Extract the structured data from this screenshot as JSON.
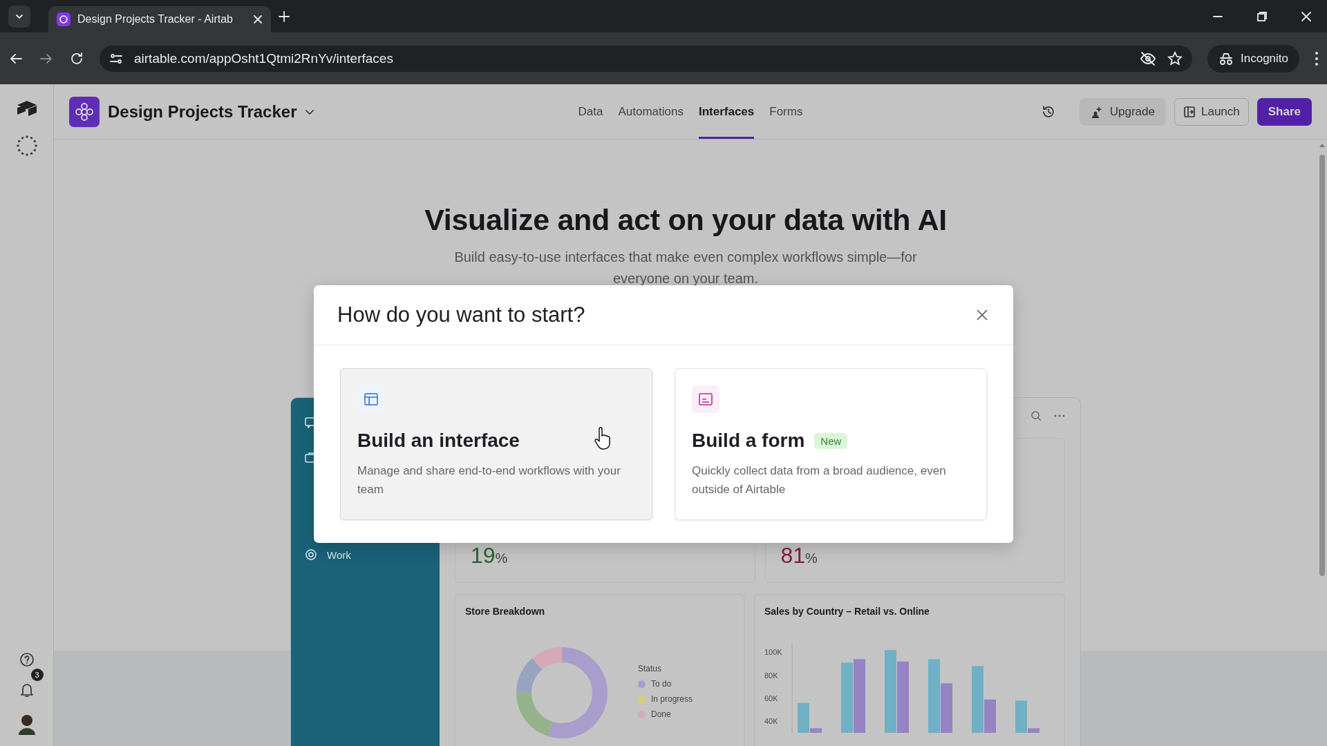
{
  "browser": {
    "tab_title": "Design Projects Tracker - Airtab",
    "url": "airtable.com/appOsht1Qtmi2RnYv/interfaces",
    "profile": "Incognito"
  },
  "rail": {
    "notification_count": "3"
  },
  "header": {
    "base_name": "Design Projects Tracker",
    "nav": [
      {
        "label": "Data",
        "selected": false
      },
      {
        "label": "Automations",
        "selected": false
      },
      {
        "label": "Interfaces",
        "selected": true
      },
      {
        "label": "Forms",
        "selected": false
      }
    ],
    "buttons": [
      {
        "label": "Upgrade",
        "kind": "upgrade"
      },
      {
        "label": "Launch",
        "kind": "launch"
      },
      {
        "label": "Share",
        "kind": "share"
      }
    ]
  },
  "hero": {
    "title": "Visualize and act on your data with AI",
    "subtitle": "Build easy-to-use interfaces that make even complex workflows simple—for everyone on your team."
  },
  "preview": {
    "sidebar_items": [
      {
        "label": "Work"
      }
    ],
    "metrics": [
      {
        "value": "19",
        "unit": "%",
        "color": "#2b6030"
      },
      {
        "value": "81",
        "unit": "%",
        "color": "#8a1a3e"
      }
    ],
    "store_breakdown": {
      "title": "Store Breakdown",
      "legend_title": "Status",
      "legend": [
        {
          "label": "To do",
          "color": "#a99dcc"
        },
        {
          "label": "In progress",
          "color": "#d2cf7a"
        },
        {
          "label": "Done",
          "color": "#d6a9b6"
        }
      ]
    },
    "sales_chart": {
      "chart_data": {
        "type": "bar",
        "title": "Sales by Country – Retail vs. Online",
        "categories": [
          null,
          null,
          null,
          null,
          null,
          null
        ],
        "ylim": [
          30000,
          108000
        ],
        "yticks": [
          {
            "value": 40000,
            "label": "40K"
          },
          {
            "value": 60000,
            "label": "60K"
          },
          {
            "value": 80000,
            "label": "80K"
          },
          {
            "value": 100000,
            "label": "100K"
          }
        ],
        "series": [
          {
            "color": "#6fb0c5",
            "values": [
              56000,
              91000,
              102000,
              94000,
              88000,
              58000
            ]
          },
          {
            "color": "#9683c4",
            "values": [
              34000,
              94000,
              92000,
              73000,
              59000,
              34000
            ]
          }
        ]
      }
    }
  },
  "modal": {
    "title": "How do you want to start?",
    "options": [
      {
        "kind": "interface",
        "title": "Build an interface",
        "description": "Manage and share end-to-end workflows with your team",
        "hovered": true
      },
      {
        "kind": "form",
        "title": "Build a form",
        "badge": "New",
        "description": "Quickly collect data from a broad audience, even outside of Airtable",
        "hovered": false
      }
    ]
  }
}
